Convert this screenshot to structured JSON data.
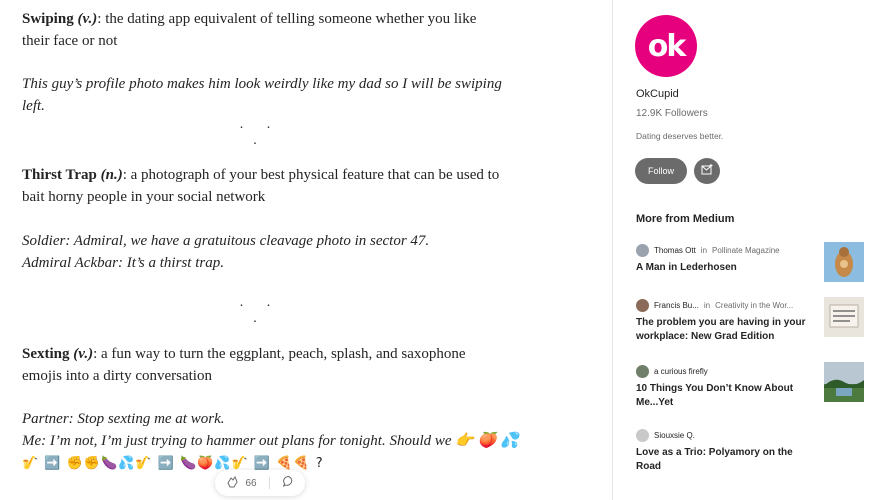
{
  "article": {
    "swiping": {
      "term": "Swiping",
      "pos": "(v.)",
      "definition": ": the dating app equivalent of telling someone whether you like their face or not",
      "example": "This guy’s profile photo makes him look weirdly like my dad so I will be swiping left."
    },
    "separator": ". . .",
    "thirst": {
      "term": "Thirst Trap",
      "pos": "(n.)",
      "definition": ": a photograph of your best physical feature that can be used to bait horny people in your social network",
      "example_line1": "Soldier: Admiral, we have a gratuitous cleavage photo in sector 47.",
      "example_line2": "Admiral Ackbar: It’s a thirst trap."
    },
    "sexting": {
      "term": "Sexting",
      "pos": "(v.)",
      "definition": ": a fun way to turn the eggplant, peach, splash, and saxophone emojis into a dirty conversation",
      "example_line1": "Partner: Stop sexting me at work.",
      "example_line2": "Me: I’m not, I’m just trying to hammer out plans for tonight. Should we 👉 🍑 💦",
      "emoji_line": "🎷 ➡️ ✊✊🍆💦🎷 ➡️ 🍆🍑💦🎷 ➡️ 🍕🍕 ?"
    },
    "claps": "66"
  },
  "sidebar": {
    "logo_text": "ok",
    "publication_name": "OkCupid",
    "followers": "12.9K Followers",
    "tagline": "Dating deserves better.",
    "follow_label": "Follow",
    "more_from": "More from Medium",
    "stories": [
      {
        "author": "Thomas Ott",
        "in": "in",
        "publication": "Pollinate Magazine",
        "title": "A Man in Lederhosen"
      },
      {
        "author": "Francis Bu...",
        "in": "in",
        "publication": "Creativity in the Wor...",
        "title": "The problem you are having in your workplace: New Grad Edition"
      },
      {
        "author": "a curious firefly",
        "in": "",
        "publication": "",
        "title": "10 Things You Don’t Know About Me...Yet"
      },
      {
        "author": "Siouxsie Q.",
        "in": "",
        "publication": "",
        "title": "Love as a Trio: Polyamory on the Road"
      }
    ]
  },
  "colors": {
    "brand": "#e6007e",
    "button": "#6b6b6b"
  },
  "icons": [
    "clap-icon",
    "comment-icon",
    "mail-plus-icon"
  ]
}
